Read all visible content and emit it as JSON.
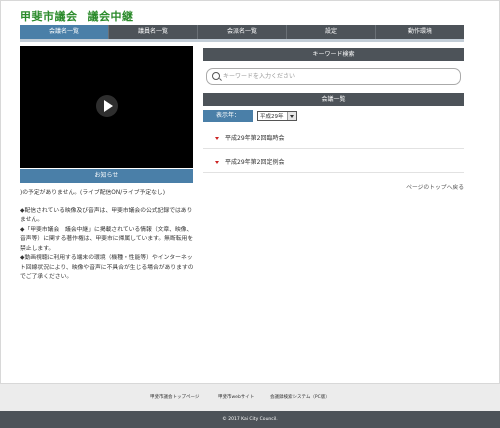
{
  "header": {
    "title_part1": "甲斐市議会",
    "title_part2": "議会中継"
  },
  "gnav": [
    "会議名一覧",
    "議員名一覧",
    "会派名一覧",
    "設定",
    "動作環境"
  ],
  "player": {
    "notice_label": "お知らせ"
  },
  "notice": {
    "status": ")の予定がありません。(ライブ配信ON/ライブ予定なし)",
    "notes": [
      "◆配信されている映像及び音声は、甲斐市議会の公式記録ではありません。",
      "◆「甲斐市議会　議会中継」に掲載されている情報（文章、映像、音声等）に関する著作権は、甲斐市に帰属しています。無断転用を禁止します。",
      "◆動画視聴に利用する端末の環境（機種・性能等）やインターネット回線状況により、映像や音声に不具合が生じる場合がありますのでご了承ください。"
    ]
  },
  "search": {
    "heading": "キーワード検索",
    "placeholder": "キーワードを入力ください"
  },
  "meetings": {
    "heading": "会議一覧",
    "year_label": "表示年：",
    "year_value": "平成29年",
    "items": [
      "平成29年第2回臨時会",
      "平成29年第2回定例会"
    ]
  },
  "page_top": "ページのトップへ戻る",
  "footer": {
    "links": [
      "甲斐市議会トップページ",
      "甲斐市webサイト",
      "会議録検索システム（PC版）"
    ],
    "copyright": "© 2017 Kai City Council."
  },
  "colors": {
    "nav_dark": "#4d5359",
    "accent_blue": "#4a7fa8",
    "title_green": "#2a8a2a",
    "bullet_red": "#cc2222"
  }
}
